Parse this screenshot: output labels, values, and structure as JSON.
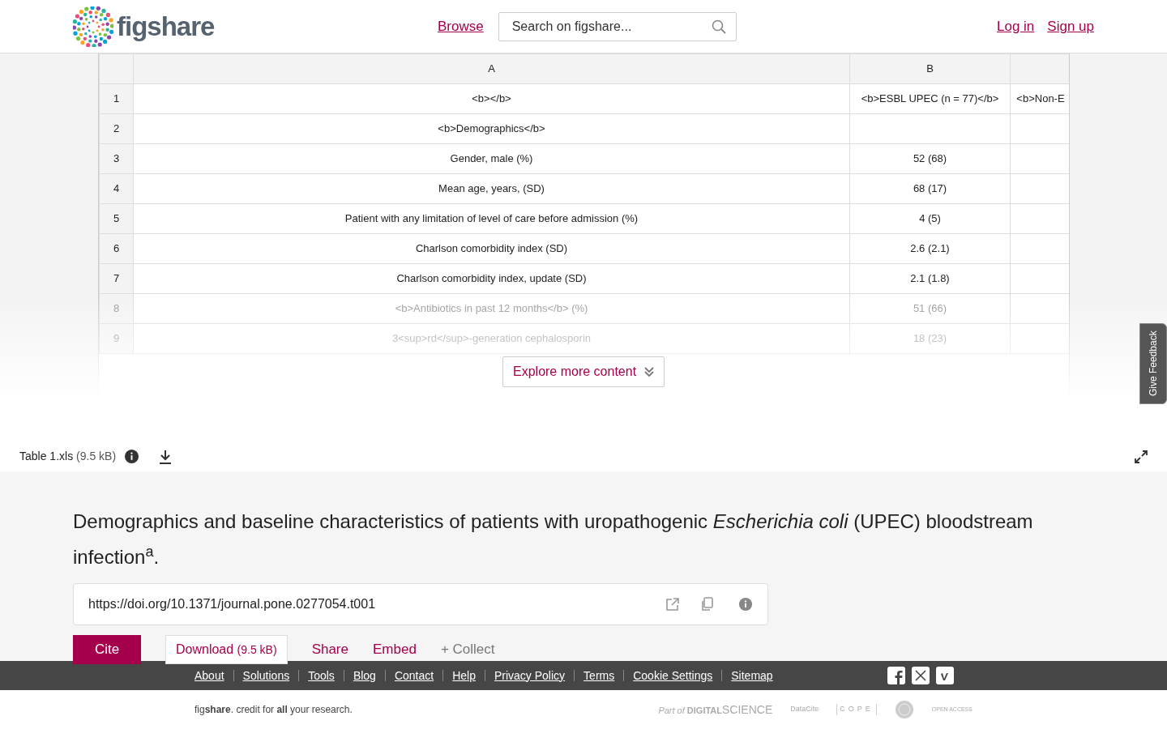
{
  "header": {
    "logo": "figshare",
    "nav": [
      {
        "label": "Browse"
      }
    ],
    "search": {
      "placeholder": "Search on figshare..."
    },
    "account": [
      {
        "label": "Log in"
      },
      {
        "label": "Sign up"
      }
    ]
  },
  "preview": {
    "columns": [
      "",
      "A",
      "B",
      ""
    ],
    "rows": [
      {
        "cells": [
          "1",
          "<b></b>",
          "<b>ESBL UPEC (n = 77)</b>",
          "<b>Non-E"
        ],
        "faded": false
      },
      {
        "cells": [
          "2",
          "<b>Demographics</b>",
          "",
          ""
        ],
        "faded": false
      },
      {
        "cells": [
          "3",
          "Gender, male (%)",
          "52 (68)",
          ""
        ],
        "faded": false
      },
      {
        "cells": [
          "4",
          "Mean age, years, (SD)",
          "68 (17)",
          ""
        ],
        "faded": false
      },
      {
        "cells": [
          "5",
          "Patient with any limitation of level of care before admission (%)",
          "4 (5)",
          ""
        ],
        "faded": false
      },
      {
        "cells": [
          "6",
          "Charlson comorbidity index (SD)",
          "2.6 (2.1)",
          ""
        ],
        "faded": false
      },
      {
        "cells": [
          "7",
          "Charlson comorbidity index, update (SD)",
          "2.1 (1.8)",
          ""
        ],
        "faded": false
      },
      {
        "cells": [
          "8",
          "<b>Antibiotics in past 12 months</b> (%)",
          "51 (66)",
          ""
        ],
        "faded": true
      },
      {
        "cells": [
          "9",
          "3<sup>rd</sup>-generation cephalosporin",
          "18 (23)",
          ""
        ],
        "faded": true
      }
    ],
    "explore_button": "Explore more content"
  },
  "feedback_tab": "Give Feedback",
  "file_bar": {
    "name": "Table 1.xls",
    "size": "(9.5 kB)"
  },
  "item": {
    "title": "Demographics and baseline characteristics of patients with uropathogenic *Escherichia coli* (UPEC) bloodstream infection$^{a}$.",
    "doi": "https://doi.org/10.1371/journal.pone.0277054.t001",
    "actions": [
      {
        "kind": "primary",
        "label": "Cite"
      },
      {
        "kind": "outline",
        "label": "Download",
        "extra": "(9.5 kB)"
      },
      {
        "kind": "link",
        "label": "Share"
      },
      {
        "kind": "link",
        "label": "Embed"
      },
      {
        "kind": "muted",
        "label": "+ Collect"
      }
    ]
  },
  "footer": {
    "links": [
      "About",
      "Solutions",
      "Tools",
      "Blog",
      "Contact",
      "Help",
      "Privacy Policy",
      "Terms",
      "Cookie Settings",
      "Sitemap"
    ],
    "tagline": "fig**share**. credit for **all** your research.",
    "partners": [
      "Part of",
      "DIGITAL",
      "SCIENCE",
      "DataCite",
      "COPE",
      "OPEN",
      "ACCESS"
    ]
  }
}
